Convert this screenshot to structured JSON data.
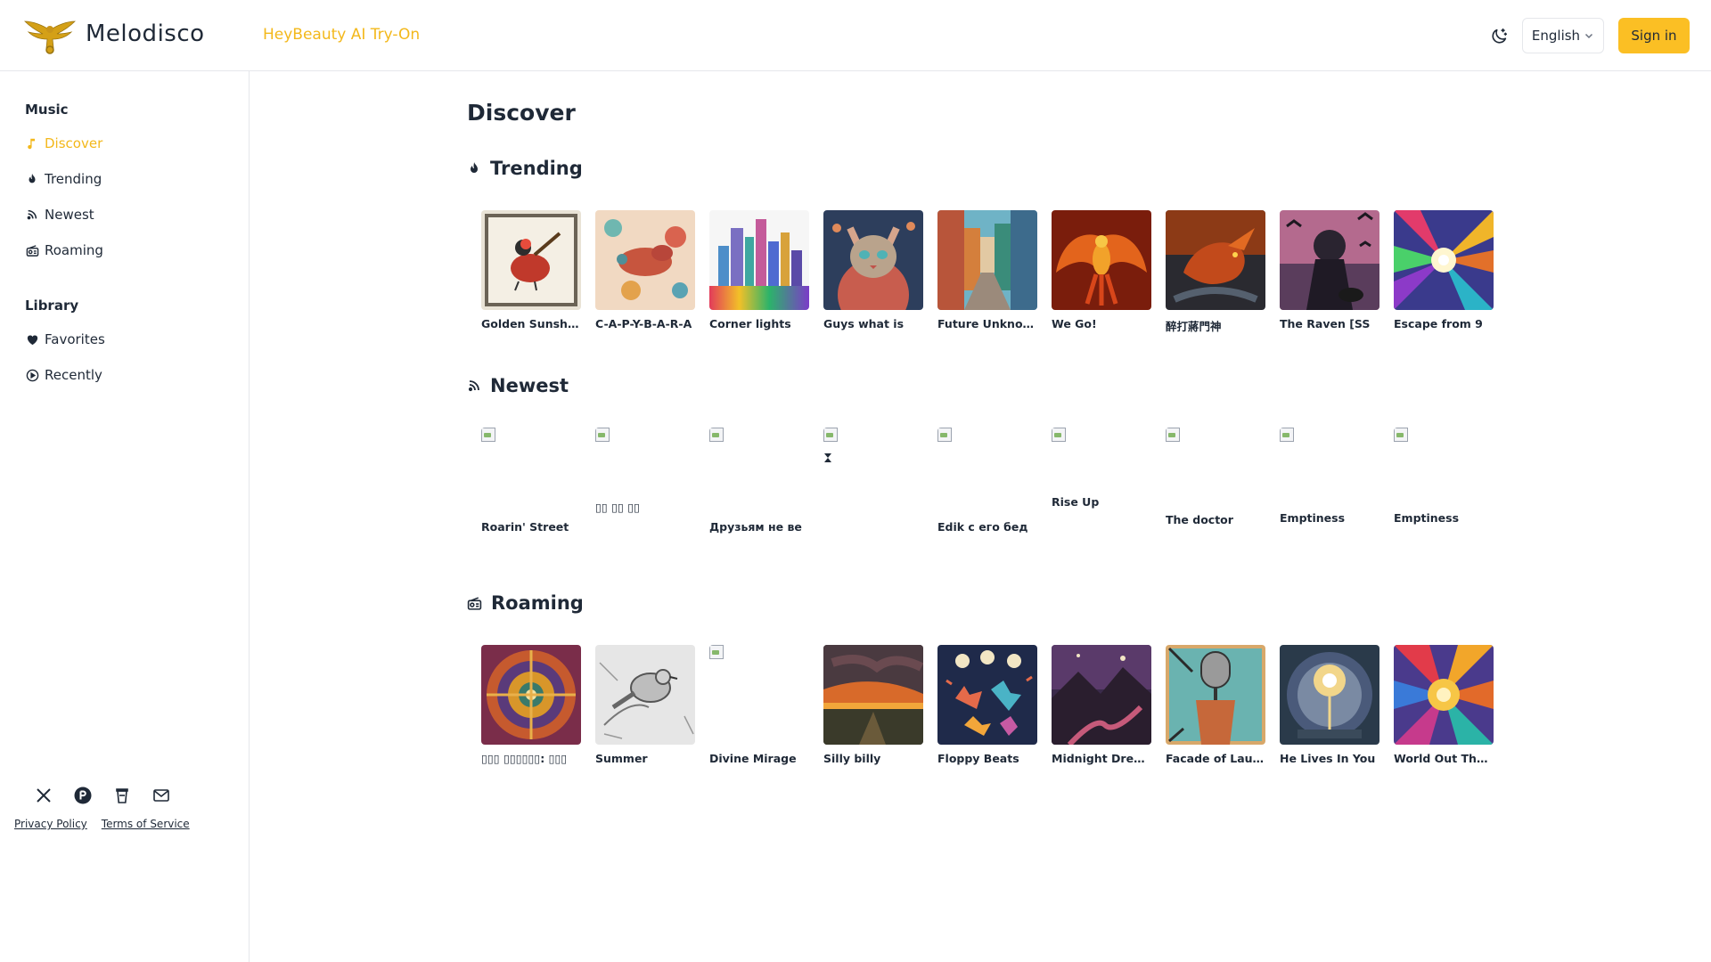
{
  "header": {
    "brand": "Melodisco",
    "ad_link": "HeyBeauty AI Try-On",
    "language": "English",
    "sign_in": "Sign in"
  },
  "sidebar": {
    "music_title": "Music",
    "music_items": [
      {
        "label": "Discover",
        "icon": "music-note-icon",
        "active": true
      },
      {
        "label": "Trending",
        "icon": "flame-icon"
      },
      {
        "label": "Newest",
        "icon": "rss-icon"
      },
      {
        "label": "Roaming",
        "icon": "radio-icon"
      }
    ],
    "library_title": "Library",
    "library_items": [
      {
        "label": "Favorites",
        "icon": "heart-icon"
      },
      {
        "label": "Recently",
        "icon": "play-circle-icon"
      }
    ],
    "social": [
      "x-icon",
      "product-hunt-icon",
      "coffee-icon",
      "mail-icon"
    ],
    "footer": {
      "privacy": "Privacy Policy",
      "terms": "Terms of Service"
    }
  },
  "main": {
    "title": "Discover",
    "sections": [
      {
        "title": "Trending",
        "icon": "flame-icon",
        "items": [
          {
            "title": "Golden Sunshine",
            "cover": "bird-guitar"
          },
          {
            "title": "C-A-P-Y-B-A-R-A",
            "cover": "pattern"
          },
          {
            "title": "Corner lights",
            "cover": "city-rainbow"
          },
          {
            "title": "Guys what is",
            "cover": "cat"
          },
          {
            "title": "Future Unknown",
            "cover": "street"
          },
          {
            "title": "We Go!",
            "cover": "phoenix"
          },
          {
            "title": "醉打蔣門神",
            "cover": "dragon"
          },
          {
            "title": "The Raven [SS",
            "cover": "raven"
          },
          {
            "title": "Escape from 9",
            "cover": "burst"
          }
        ]
      },
      {
        "title": "Newest",
        "icon": "rss-icon",
        "items": [
          {
            "title": "Roarin' Street",
            "offset": 96
          },
          {
            "title": "▯▯ ▯▯ ▯▯",
            "offset": 74
          },
          {
            "title": "Друзьям не ве",
            "offset": 96
          },
          {
            "title": "",
            "offset": 28
          },
          {
            "title": "Edik с его бед",
            "offset": 96
          },
          {
            "title": "Rise Up",
            "offset": 68
          },
          {
            "title": "The doctor",
            "offset": 88
          },
          {
            "title": "Emptiness",
            "offset": 86
          },
          {
            "title": "Emptiness",
            "offset": 86
          }
        ]
      },
      {
        "title": "Roaming",
        "icon": "radio-icon",
        "items": [
          {
            "title": "▯▯▯ ▯▯▯▯▯▯: ▯▯▯",
            "cover": "mandala"
          },
          {
            "title": "Summer",
            "cover": "sketch-bird"
          },
          {
            "title": "Divine Mirage",
            "cover": "broken"
          },
          {
            "title": "Silly billy",
            "cover": "sunset-field"
          },
          {
            "title": "Floppy Beats",
            "cover": "deer"
          },
          {
            "title": "Midnight Dreams",
            "cover": "valley"
          },
          {
            "title": "Facade of Laughter",
            "cover": "microphone"
          },
          {
            "title": "He Lives In You",
            "cover": "portal"
          },
          {
            "title": "World Out There",
            "cover": "sun-burst"
          }
        ]
      }
    ]
  },
  "colors": {
    "accent": "#fbbf24",
    "accent_text": "#f3b81b",
    "border": "#e5e7eb"
  }
}
